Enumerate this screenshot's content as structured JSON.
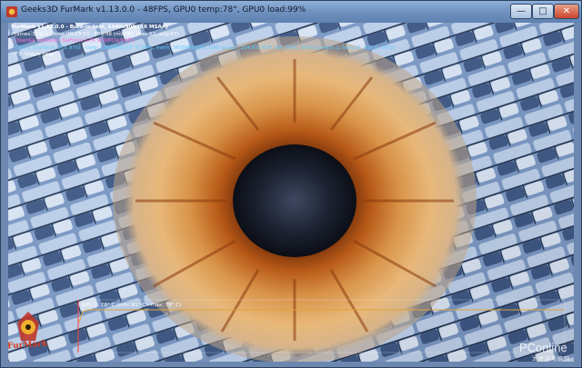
{
  "window": {
    "title": "Geeks3D FurMark v1.13.0.0 - 48FPS, GPU0 temp:78°, GPU0 load:99%",
    "minimize_glyph": "—",
    "maximize_glyph": "□",
    "close_glyph": "✕"
  },
  "hud": {
    "line1": "FurMark v1.13.0.0 - Burn-in test, 1440x900 (8X MSAA)",
    "line2": "Frames:11914 - time:00:03:53 - FPS:48 (min:47, max:52, avg:47)",
    "line3": "- OpenGL renderer: GeForce GTX 970/PCIe/SSE2",
    "line4": "- GPU 1 (GeForce GTX 970) - core: 1366MHz/78 °C/99%, mem: 3605MHz/0%, GPU power: 104.8% TDP, fan: 58%, limits:[power:1, temp:0, volt:0, OV:0]",
    "line5": "- F1: toggle help"
  },
  "temp_graph": {
    "label": "GPU 1: 78° C (min: 61° C - max: 78° C)"
  },
  "logo": {
    "text": "FurMark"
  },
  "watermark": {
    "text": "PConline",
    "sub": "太平洋电脑网"
  },
  "colors": {
    "hud_highlight": "#5fd0ff",
    "graph_line": "#e0a23a",
    "iris_dark": "#8a3a0c"
  }
}
